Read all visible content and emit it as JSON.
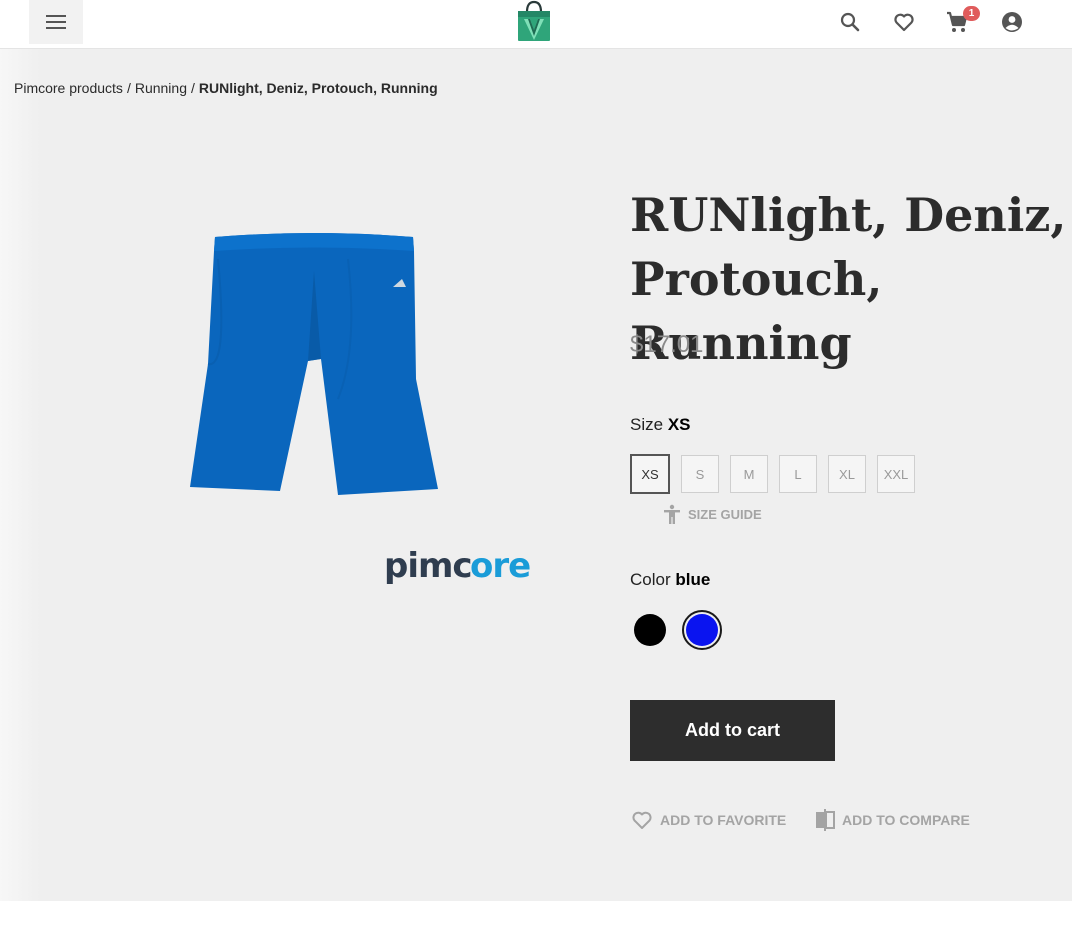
{
  "header": {
    "menu_icon": "menu-icon",
    "logo_icon": "shopping-bag-logo",
    "icons": [
      "search-icon",
      "heart-icon",
      "cart-icon",
      "account-icon"
    ],
    "cart_count": "1"
  },
  "breadcrumb": {
    "items": [
      "Pimcore products",
      "Running"
    ],
    "separator": "/",
    "current": "RUNlight, Deniz, Protouch, Running"
  },
  "gallery": {
    "image_icon": "blue-running-shorts-image",
    "brand_logo_text": "pimcore"
  },
  "product": {
    "title": "RUNlight, Deniz, Protouch, Running",
    "price": "$17.01",
    "size_label": "Size",
    "selected_size": "XS",
    "sizes": [
      "XS",
      "S",
      "M",
      "L",
      "XL",
      "XXL"
    ],
    "size_guide": "SIZE GUIDE",
    "color_label": "Color",
    "selected_color": "blue",
    "colors": [
      {
        "name": "black",
        "hex": "#000000"
      },
      {
        "name": "blue",
        "hex": "#0a14f0"
      }
    ],
    "add_to_cart": "Add to cart",
    "add_to_favorite": "ADD TO FAVORITE",
    "add_to_compare": "ADD TO COMPARE"
  },
  "colors": {
    "accent_green": "#3aa57a",
    "badge": "#e05c5c",
    "button_dark": "#2d2d2d",
    "page_bg": "#efefef"
  }
}
